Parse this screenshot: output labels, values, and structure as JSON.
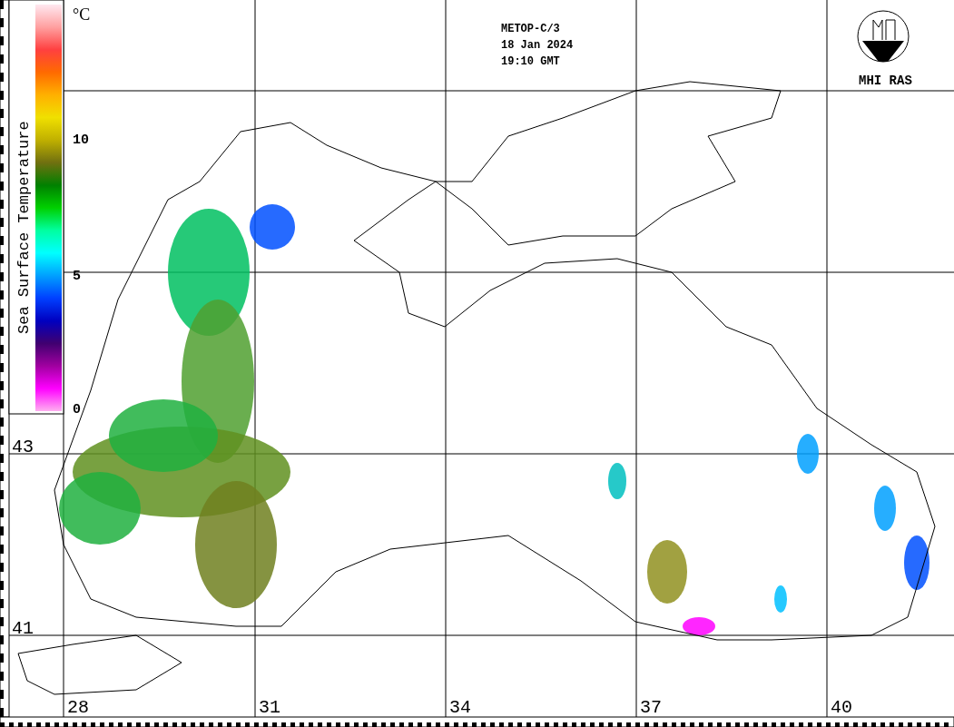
{
  "legend": {
    "title": "Sea Surface Temperature",
    "unit": "°C",
    "ticks": [
      "10",
      "5",
      "0"
    ]
  },
  "header": {
    "lines": [
      "METOP-C/3",
      "18 Jan 2024",
      "19:10 GMT"
    ]
  },
  "logo": {
    "caption": "MHI RAS"
  },
  "map": {
    "latitude_labels": [
      "43",
      "41"
    ],
    "longitude_labels": [
      "28",
      "31",
      "34",
      "37",
      "40"
    ]
  }
}
